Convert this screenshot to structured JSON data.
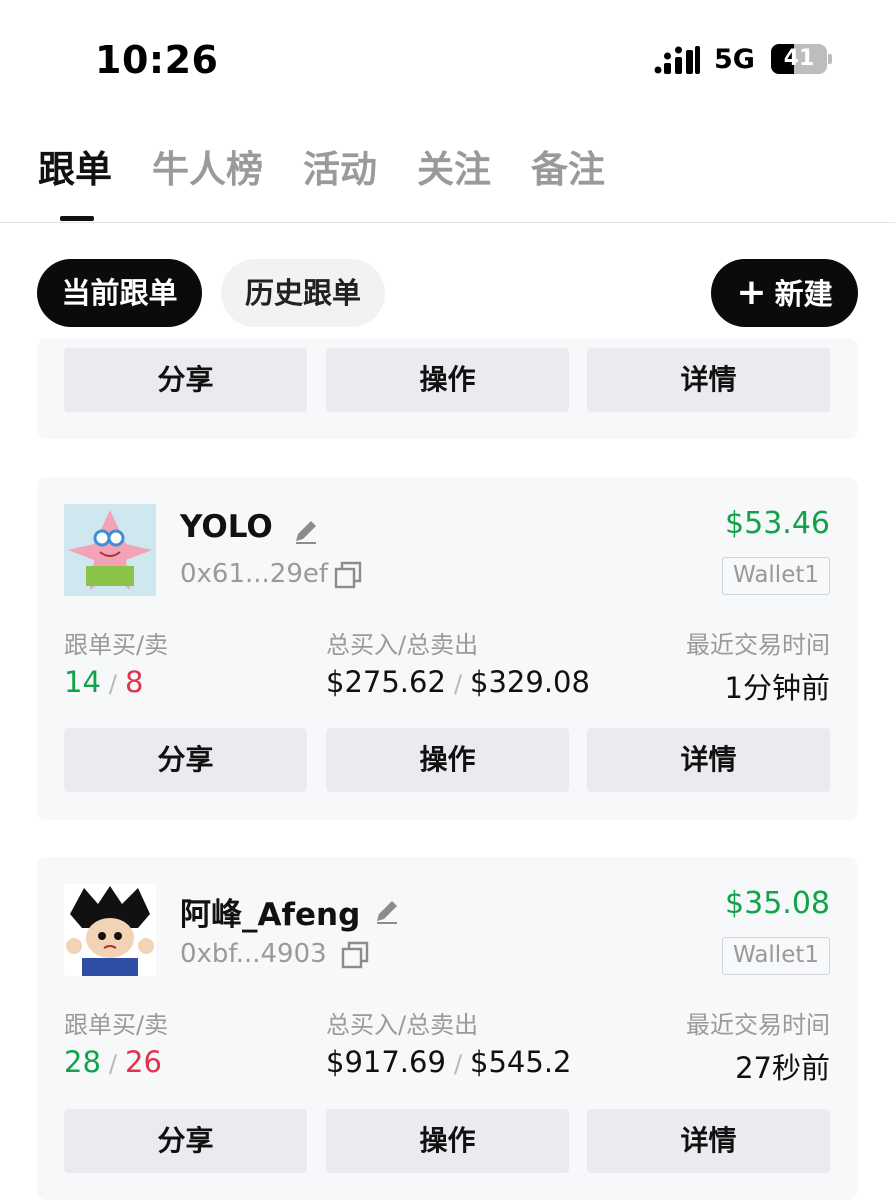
{
  "status_bar": {
    "time": "10:26",
    "network": "5G",
    "battery": "41"
  },
  "tabs": [
    {
      "label": "跟单",
      "active": true
    },
    {
      "label": "牛人榜",
      "active": false
    },
    {
      "label": "活动",
      "active": false
    },
    {
      "label": "关注",
      "active": false
    },
    {
      "label": "备注",
      "active": false
    }
  ],
  "filters": {
    "current": "当前跟单",
    "history": "历史跟单",
    "new_label": "新建"
  },
  "actions": {
    "share": "分享",
    "operate": "操作",
    "detail": "详情"
  },
  "labels": {
    "buy_sell": "跟单买/卖",
    "totals": "总买入/总卖出",
    "last_trade": "最近交易时间",
    "slash": "/"
  },
  "cards": [
    {
      "name": "YOLO",
      "address": "0x61...29ef",
      "amount": "$53.46",
      "wallet": "Wallet1",
      "buy_count": "14",
      "sell_count": "8",
      "total_buy": "$275.62",
      "total_sell": "$329.08",
      "last_trade": "1分钟前"
    },
    {
      "name": "阿峰_Afeng",
      "address": "0xbf...4903",
      "amount": "$35.08",
      "wallet": "Wallet1",
      "buy_count": "28",
      "sell_count": "26",
      "total_buy": "$917.69",
      "total_sell": "$545.2",
      "last_trade": "27秒前"
    }
  ],
  "colors": {
    "positive": "#12a34a",
    "negative": "#e0344d",
    "card_bg": "#f7f8fa",
    "button_bg": "#e9ebee"
  }
}
